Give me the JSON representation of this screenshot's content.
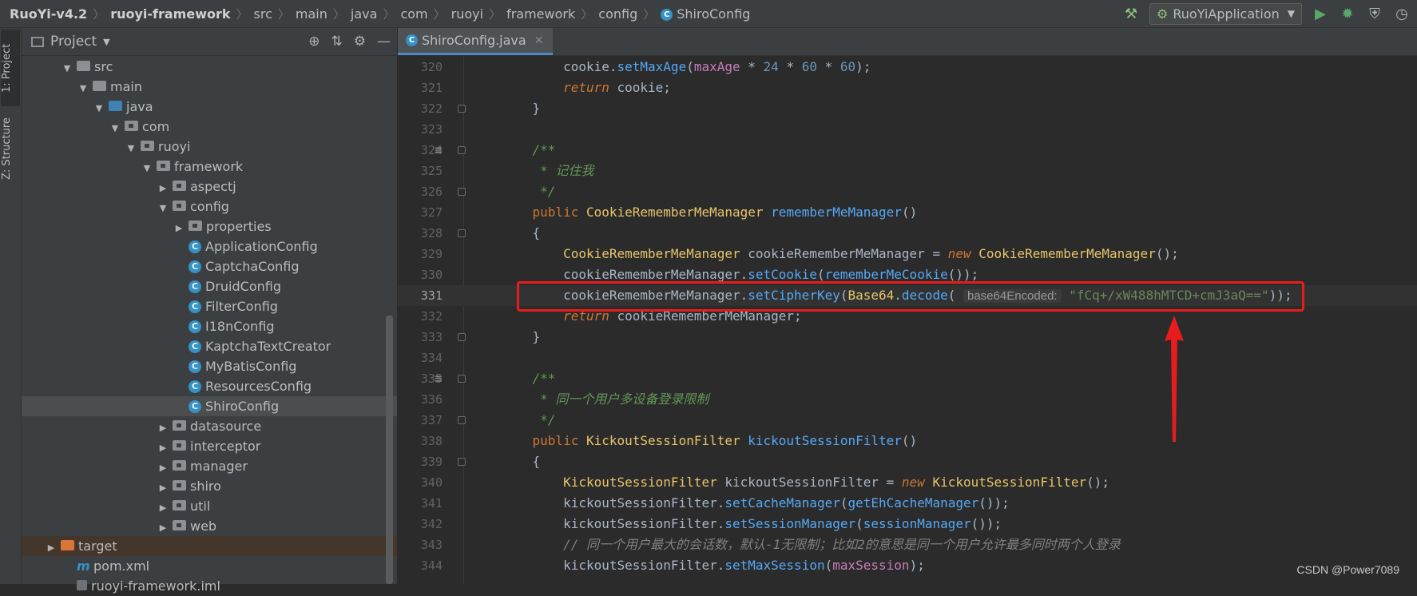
{
  "breadcrumb": [
    "RuoYi-v4.2",
    "ruoyi-framework",
    "src",
    "main",
    "java",
    "com",
    "ruoyi",
    "framework",
    "config",
    "ShiroConfig"
  ],
  "run_config": {
    "label": "RuoYiApplication"
  },
  "toolwindows": {
    "project_tab": "1: Project",
    "structure_tab": "Z: Structure"
  },
  "project_panel": {
    "title": "Project"
  },
  "tree": [
    {
      "label": "src",
      "kind": "folder",
      "depth": 2,
      "open": true
    },
    {
      "label": "main",
      "kind": "folder",
      "depth": 3,
      "open": true
    },
    {
      "label": "java",
      "kind": "folder-blue",
      "depth": 4,
      "open": true
    },
    {
      "label": "com",
      "kind": "package",
      "depth": 5,
      "open": true
    },
    {
      "label": "ruoyi",
      "kind": "package",
      "depth": 6,
      "open": true
    },
    {
      "label": "framework",
      "kind": "package",
      "depth": 7,
      "open": true
    },
    {
      "label": "aspectj",
      "kind": "package",
      "depth": 8,
      "open": false
    },
    {
      "label": "config",
      "kind": "package",
      "depth": 8,
      "open": true
    },
    {
      "label": "properties",
      "kind": "package",
      "depth": 9,
      "open": false
    },
    {
      "label": "ApplicationConfig",
      "kind": "class",
      "depth": 9
    },
    {
      "label": "CaptchaConfig",
      "kind": "class",
      "depth": 9
    },
    {
      "label": "DruidConfig",
      "kind": "class",
      "depth": 9
    },
    {
      "label": "FilterConfig",
      "kind": "class",
      "depth": 9
    },
    {
      "label": "I18nConfig",
      "kind": "class",
      "depth": 9
    },
    {
      "label": "KaptchaTextCreator",
      "kind": "class",
      "depth": 9
    },
    {
      "label": "MyBatisConfig",
      "kind": "class",
      "depth": 9
    },
    {
      "label": "ResourcesConfig",
      "kind": "class",
      "depth": 9
    },
    {
      "label": "ShiroConfig",
      "kind": "class",
      "depth": 9,
      "selected": true
    },
    {
      "label": "datasource",
      "kind": "package",
      "depth": 8,
      "open": false
    },
    {
      "label": "interceptor",
      "kind": "package",
      "depth": 8,
      "open": false
    },
    {
      "label": "manager",
      "kind": "package",
      "depth": 8,
      "open": false
    },
    {
      "label": "shiro",
      "kind": "package",
      "depth": 8,
      "open": false
    },
    {
      "label": "util",
      "kind": "package",
      "depth": 8,
      "open": false
    },
    {
      "label": "web",
      "kind": "package",
      "depth": 8,
      "open": false
    },
    {
      "label": "target",
      "kind": "folder-orange",
      "depth": 1,
      "open": false,
      "highlight": true
    },
    {
      "label": "pom.xml",
      "kind": "maven",
      "depth": 2
    },
    {
      "label": "ruoyi-framework.iml",
      "kind": "file",
      "depth": 2
    }
  ],
  "editor": {
    "tab_label": "ShiroConfig.java",
    "current_line": 331,
    "lines": [
      {
        "n": 320,
        "tokens": [
          [
            "pl",
            "        cookie."
          ],
          [
            "mth",
            "setMaxAge"
          ],
          [
            "pl",
            "("
          ],
          [
            "fld",
            "maxAge"
          ],
          [
            "pl",
            " * "
          ],
          [
            "num",
            "24"
          ],
          [
            "pl",
            " * "
          ],
          [
            "num",
            "60"
          ],
          [
            "pl",
            " * "
          ],
          [
            "num",
            "60"
          ],
          [
            "pl",
            ");"
          ]
        ]
      },
      {
        "n": 321,
        "tokens": [
          [
            "kwi",
            "        return"
          ],
          [
            "pl",
            " cookie;"
          ]
        ]
      },
      {
        "n": 322,
        "tokens": [
          [
            "pl",
            "    }"
          ]
        ]
      },
      {
        "n": 323,
        "tokens": []
      },
      {
        "n": 324,
        "tokens": [
          [
            "cmt",
            "    /**"
          ]
        ]
      },
      {
        "n": 325,
        "tokens": [
          [
            "cmt",
            "     * 记住我"
          ]
        ]
      },
      {
        "n": 326,
        "tokens": [
          [
            "cmt",
            "     */"
          ]
        ]
      },
      {
        "n": 327,
        "tokens": [
          [
            "kw",
            "    public "
          ],
          [
            "ty",
            "CookieRememberMeManager"
          ],
          [
            "pl",
            " "
          ],
          [
            "mth",
            "rememberMeManager"
          ],
          [
            "pl",
            "()"
          ]
        ]
      },
      {
        "n": 328,
        "tokens": [
          [
            "pl",
            "    {"
          ]
        ]
      },
      {
        "n": 329,
        "tokens": [
          [
            "ty",
            "        CookieRememberMeManager"
          ],
          [
            "pl",
            " cookieRememberMeManager = "
          ],
          [
            "kwi",
            "new"
          ],
          [
            "pl",
            " "
          ],
          [
            "ty",
            "CookieRememberMeManager"
          ],
          [
            "pl",
            "();"
          ]
        ]
      },
      {
        "n": 330,
        "tokens": [
          [
            "pl",
            "        cookieRememberMeManager."
          ],
          [
            "mth",
            "setCookie"
          ],
          [
            "pl",
            "("
          ],
          [
            "mth",
            "rememberMeCookie"
          ],
          [
            "pl",
            "());"
          ]
        ]
      },
      {
        "n": 331,
        "tokens": [
          [
            "pl",
            "        cookieRememberMeManager."
          ],
          [
            "mth",
            "setCipherKey"
          ],
          [
            "pl",
            "("
          ],
          [
            "ty",
            "Base64"
          ],
          [
            "pl",
            "."
          ],
          [
            "mth",
            "decode"
          ],
          [
            "pl",
            "( "
          ],
          [
            "hint",
            "base64Encoded:"
          ],
          [
            "pl",
            " "
          ],
          [
            "str",
            "\"fCq+/xW488hMTCD+cmJ3aQ==\""
          ],
          [
            "pl",
            "));"
          ]
        ]
      },
      {
        "n": 332,
        "tokens": [
          [
            "kwi",
            "        return"
          ],
          [
            "pl",
            " cookieRememberMeManager;"
          ]
        ]
      },
      {
        "n": 333,
        "tokens": [
          [
            "pl",
            "    }"
          ]
        ]
      },
      {
        "n": 334,
        "tokens": []
      },
      {
        "n": 335,
        "tokens": [
          [
            "cmt",
            "    /**"
          ]
        ]
      },
      {
        "n": 336,
        "tokens": [
          [
            "cmt",
            "     * 同一个用户多设备登录限制"
          ]
        ]
      },
      {
        "n": 337,
        "tokens": [
          [
            "cmt",
            "     */"
          ]
        ]
      },
      {
        "n": 338,
        "tokens": [
          [
            "kw",
            "    public "
          ],
          [
            "ty",
            "KickoutSessionFilter"
          ],
          [
            "pl",
            " "
          ],
          [
            "mth",
            "kickoutSessionFilter"
          ],
          [
            "pl",
            "()"
          ]
        ]
      },
      {
        "n": 339,
        "tokens": [
          [
            "pl",
            "    {"
          ]
        ]
      },
      {
        "n": 340,
        "tokens": [
          [
            "ty",
            "        KickoutSessionFilter"
          ],
          [
            "pl",
            " kickoutSessionFilter = "
          ],
          [
            "kwi",
            "new"
          ],
          [
            "pl",
            " "
          ],
          [
            "ty",
            "KickoutSessionFilter"
          ],
          [
            "pl",
            "();"
          ]
        ]
      },
      {
        "n": 341,
        "tokens": [
          [
            "pl",
            "        kickoutSessionFilter."
          ],
          [
            "mth",
            "setCacheManager"
          ],
          [
            "pl",
            "("
          ],
          [
            "mth",
            "getEhCacheManager"
          ],
          [
            "pl",
            "());"
          ]
        ]
      },
      {
        "n": 342,
        "tokens": [
          [
            "pl",
            "        kickoutSessionFilter."
          ],
          [
            "mth",
            "setSessionManager"
          ],
          [
            "pl",
            "("
          ],
          [
            "mth",
            "sessionManager"
          ],
          [
            "pl",
            "());"
          ]
        ]
      },
      {
        "n": 343,
        "tokens": [
          [
            "cmtg",
            "        // 同一个用户最大的会话数，默认-1无限制；比如2的意思是同一个用户允许最多同时两个人登录"
          ]
        ]
      },
      {
        "n": 344,
        "tokens": [
          [
            "pl",
            "        kickoutSessionFilter."
          ],
          [
            "mth",
            "setMaxSession"
          ],
          [
            "pl",
            "("
          ],
          [
            "fld",
            "maxSession"
          ],
          [
            "pl",
            ");"
          ]
        ]
      }
    ]
  },
  "annotation_color": "#e81c1c",
  "watermark": "CSDN @Power7089"
}
